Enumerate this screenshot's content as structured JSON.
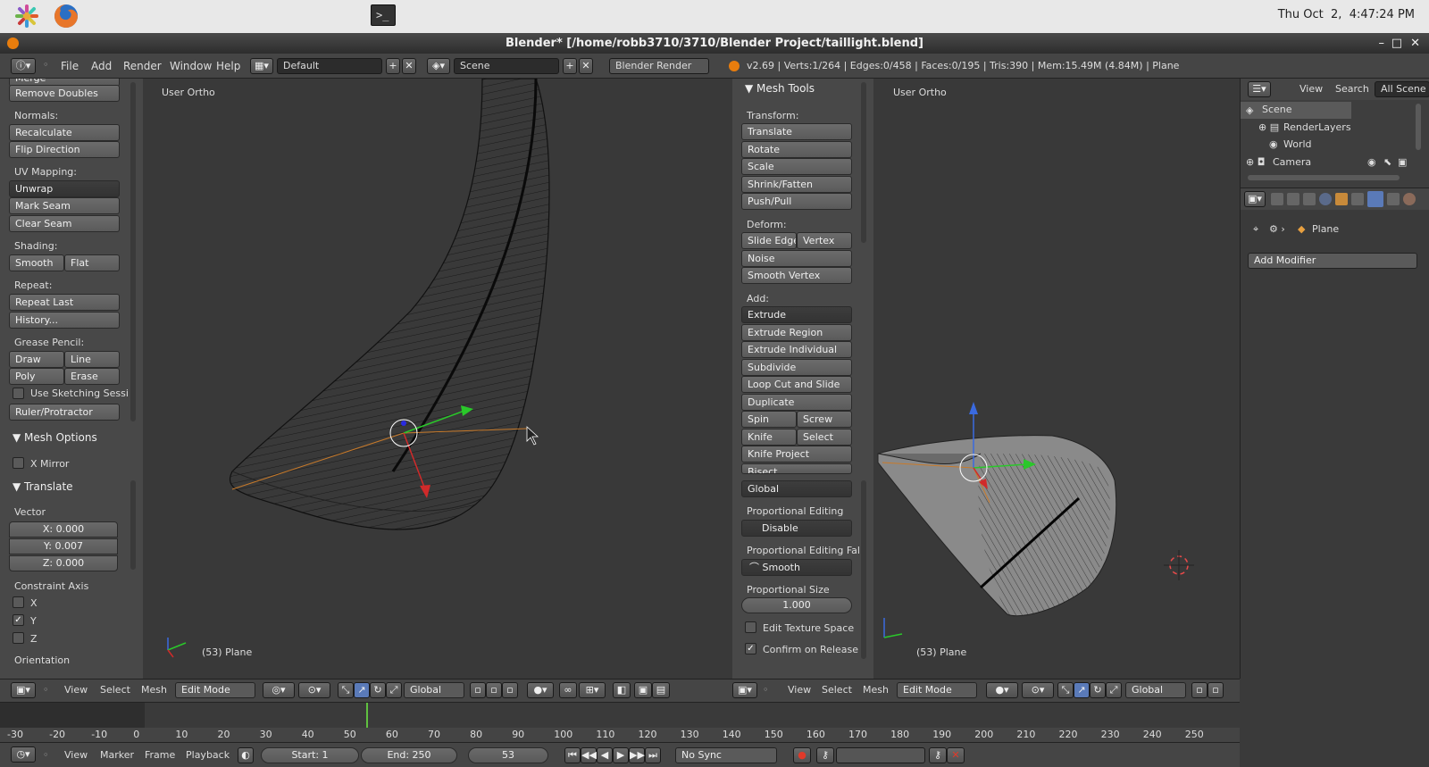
{
  "system": {
    "clock": "Thu Oct  2,  4:47:24 PM"
  },
  "window": {
    "title": "Blender* [/home/robb3710/3710/Blender Project/taillight.blend]"
  },
  "infobar": {
    "menus": [
      "File",
      "Add",
      "Render",
      "Window",
      "Help"
    ],
    "layout": "Default",
    "scene": "Scene",
    "engine": "Blender Render",
    "stats": "v2.69 | Verts:1/264 | Edges:0/458 | Faces:0/195 | Tris:390 | Mem:15.49M (4.84M) | Plane"
  },
  "left_panel": {
    "partial_header": "Merge",
    "remove_doubles": "Remove Doubles",
    "normals_label": "Normals:",
    "recalculate": "Recalculate",
    "flip_direction": "Flip Direction",
    "uv_label": "UV Mapping:",
    "unwrap": "Unwrap",
    "mark_seam": "Mark Seam",
    "clear_seam": "Clear Seam",
    "shading_label": "Shading:",
    "smooth": "Smooth",
    "flat": "Flat",
    "repeat_label": "Repeat:",
    "repeat_last": "Repeat Last",
    "history": "History...",
    "grease_label": "Grease Pencil:",
    "draw": "Draw",
    "line": "Line",
    "poly": "Poly",
    "erase": "Erase",
    "use_sketching": "Use Sketching Sessi",
    "ruler": "Ruler/Protractor",
    "mesh_options": "Mesh Options",
    "x_mirror": "X Mirror",
    "translate_hdr": "Translate",
    "vector_label": "Vector",
    "vx": "X: 0.000",
    "vy": "Y: 0.007",
    "vz": "Z: 0.000",
    "constraint_label": "Constraint Axis",
    "cx": "X",
    "cy": "Y",
    "cz": "Z",
    "orientation_label": "Orientation"
  },
  "viewport_left": {
    "view_label": "User Ortho",
    "object_label": "(53) Plane"
  },
  "viewport_right": {
    "view_label": "User Ortho",
    "object_label": "(53) Plane"
  },
  "mesh_tools": {
    "title": "Mesh Tools",
    "transform_label": "Transform:",
    "translate": "Translate",
    "rotate": "Rotate",
    "scale": "Scale",
    "shrink": "Shrink/Fatten",
    "pushpull": "Push/Pull",
    "deform_label": "Deform:",
    "slide_edge": "Slide Edge",
    "vertex": "Vertex",
    "noise": "Noise",
    "smooth_vertex": "Smooth Vertex",
    "add_label": "Add:",
    "extrude": "Extrude",
    "extrude_region": "Extrude Region",
    "extrude_individual": "Extrude Individual",
    "subdivide": "Subdivide",
    "loop_cut": "Loop Cut and Slide",
    "duplicate": "Duplicate",
    "spin": "Spin",
    "screw": "Screw",
    "knife": "Knife",
    "select": "Select",
    "knife_project": "Knife Project",
    "bisect": "Bisect",
    "global": "Global",
    "prop_edit_label": "Proportional Editing",
    "disable": "Disable",
    "prop_fall_label": "Proportional Editing Fall",
    "smooth": "Smooth",
    "prop_size_label": "Proportional Size",
    "prop_size": "1.000",
    "edit_texture": "Edit Texture Space",
    "confirm_release": "Confirm on Release"
  },
  "outliner": {
    "view": "View",
    "search": "Search",
    "all_scenes": "All Scene",
    "items": [
      "Scene",
      "RenderLayers",
      "World",
      "Camera"
    ]
  },
  "properties": {
    "object": "Plane",
    "add_modifier": "Add Modifier"
  },
  "view3d_header": {
    "view": "View",
    "select": "Select",
    "mesh": "Mesh",
    "mode": "Edit Mode",
    "orientation": "Global"
  },
  "timeline": {
    "ticks": [
      "-30",
      "-20",
      "-10",
      "0",
      "10",
      "20",
      "30",
      "40",
      "50",
      "60",
      "70",
      "80",
      "90",
      "100",
      "110",
      "120",
      "130",
      "140",
      "150",
      "160",
      "170",
      "180",
      "190",
      "200",
      "210",
      "220",
      "230",
      "240",
      "250"
    ],
    "view": "View",
    "marker": "Marker",
    "frame": "Frame",
    "playback": "Playback",
    "start": "Start: 1",
    "end": "End: 250",
    "current": "53",
    "sync": "No Sync"
  }
}
